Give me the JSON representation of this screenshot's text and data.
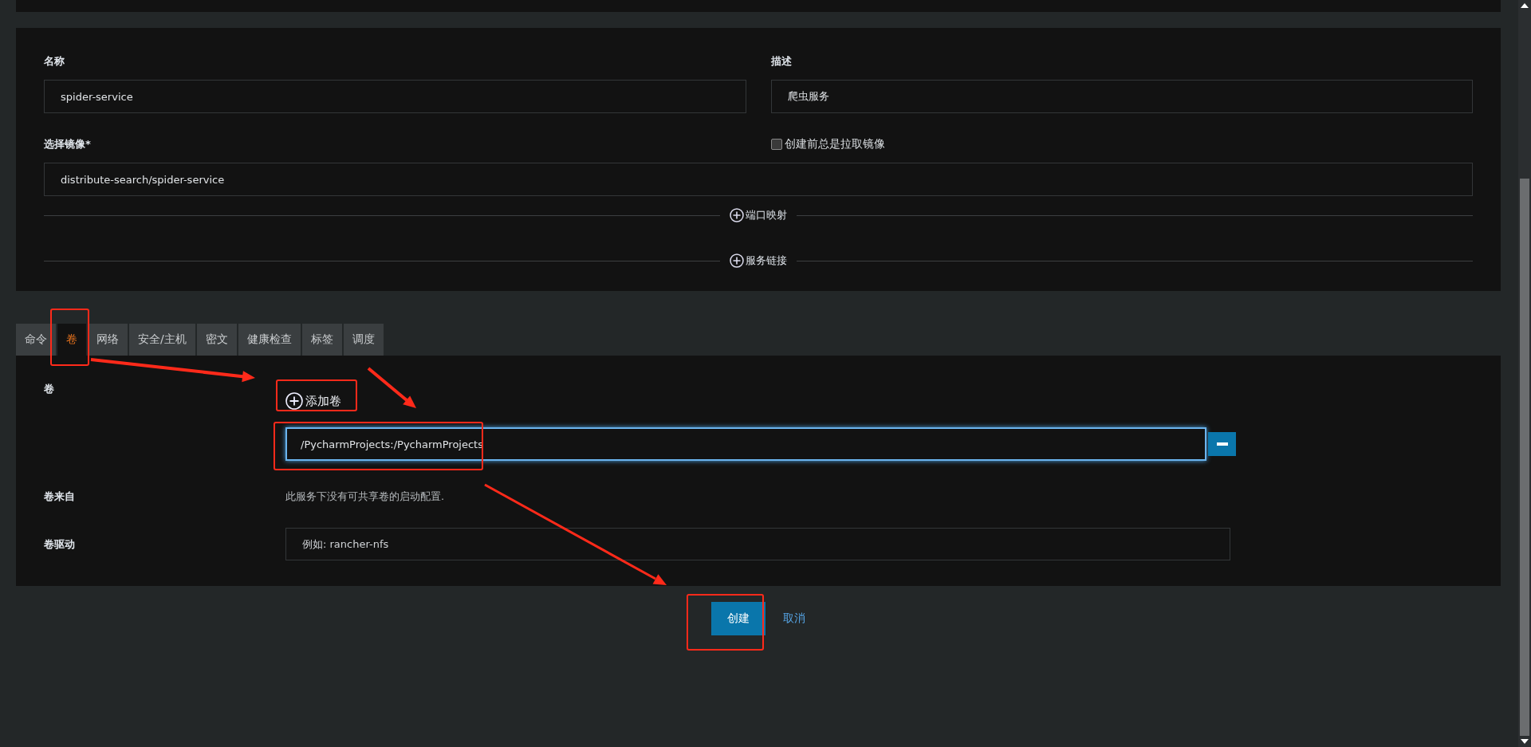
{
  "form": {
    "name": {
      "label": "名称",
      "value": "spider-service"
    },
    "description": {
      "label": "描述",
      "value": "爬虫服务"
    },
    "image": {
      "label": "选择镜像*",
      "value": "distribute-search/spider-service"
    },
    "always_pull": {
      "label": "创建前总是拉取镜像",
      "checked": false
    },
    "expanders": [
      "端口映射",
      "服务链接"
    ]
  },
  "tabs": [
    {
      "label": "命令",
      "selected": false
    },
    {
      "label": "卷",
      "selected": true
    },
    {
      "label": "网络",
      "selected": false
    },
    {
      "label": "安全/主机",
      "selected": false
    },
    {
      "label": "密文",
      "selected": false
    },
    {
      "label": "健康检查",
      "selected": false
    },
    {
      "label": "标签",
      "selected": false
    },
    {
      "label": "调度",
      "selected": false
    }
  ],
  "volumes": {
    "label": "卷",
    "add_button": "添加卷",
    "entries": [
      {
        "value": "/PycharmProjects:/PycharmProjects",
        "focused": true
      }
    ],
    "volumes_from": {
      "label": "卷来自",
      "text": "此服务下没有可共享卷的启动配置."
    },
    "driver": {
      "label": "卷驱动",
      "placeholder": "例如: rancher-nfs"
    }
  },
  "actions": {
    "create": "创建",
    "cancel": "取消"
  }
}
